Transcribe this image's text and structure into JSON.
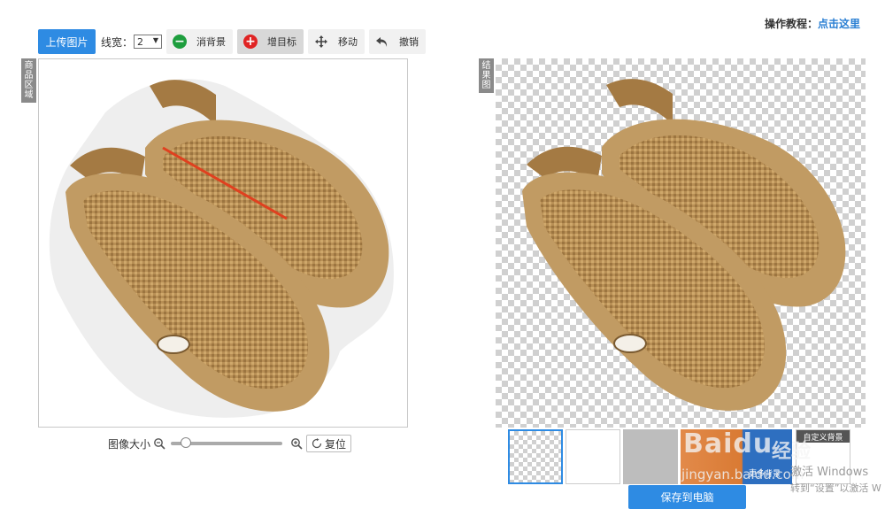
{
  "tutorial": {
    "label": "操作教程：",
    "link": "点击这里"
  },
  "toolbar": {
    "upload": "上传图片",
    "line_width_label": "线宽：",
    "line_width_value": "2",
    "remove_bg": "消背景",
    "add_target": "增目标",
    "move": "移动",
    "undo": "撤销"
  },
  "panels": {
    "product_label": [
      "商",
      "品",
      "区",
      "域"
    ],
    "result_label": [
      "结",
      "果",
      "图"
    ]
  },
  "zoom": {
    "label": "图像大小",
    "reset": "复位",
    "level": 0.1
  },
  "backgrounds": {
    "more": "更多背景",
    "custom": "自定义背景"
  },
  "save": "保存到电脑",
  "watermark": {
    "brand": "Baidu",
    "brand_cn": "经验",
    "site": "jingyan.baidu.com",
    "win1": "激活 Windows",
    "win2": "转到“设置”以激活 W"
  },
  "colors": {
    "accent": "#2e8be3",
    "remove": "#1e9e3e",
    "add": "#e02424",
    "sandal": "#b88f55"
  }
}
